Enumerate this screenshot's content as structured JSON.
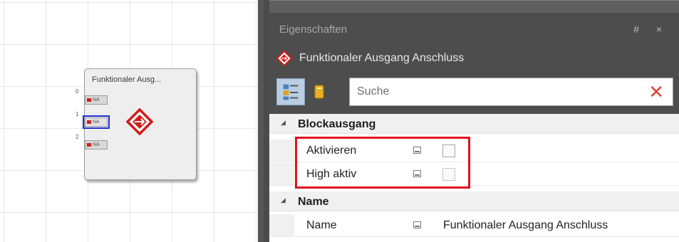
{
  "canvas": {
    "block": {
      "title": "Funktionaler Ausg...",
      "pins": [
        {
          "number": "0",
          "label": "NA"
        },
        {
          "number": "1",
          "label": "NA"
        },
        {
          "number": "2",
          "label": "NA"
        }
      ]
    }
  },
  "panel": {
    "title": "Eigenschaften",
    "controls": "# ×",
    "object_title": "Funktionaler Ausgang Anschluss",
    "search": {
      "placeholder": "Suche",
      "clear_symbol": "✕"
    },
    "categories": [
      {
        "label": "Blockausgang",
        "rows": [
          {
            "name": "Aktivieren",
            "checked": false
          },
          {
            "name": "High aktiv",
            "checked": false
          }
        ]
      },
      {
        "label": "Name",
        "rows": [
          {
            "name": "Name",
            "value": "Funktionaler Ausgang Anschluss"
          }
        ]
      }
    ]
  },
  "colors": {
    "accent_red": "#e2111b",
    "selection_blue": "#1b2fd0",
    "panel_dark": "#4b4b4b"
  }
}
